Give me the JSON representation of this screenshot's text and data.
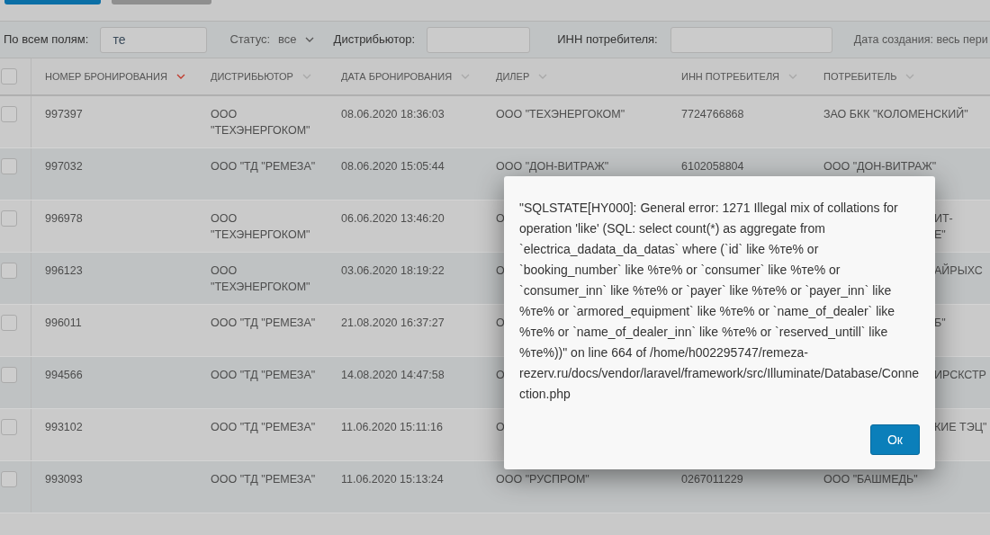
{
  "toolbar": {
    "buttons": [
      {
        "kind": "primary"
      },
      {
        "kind": "secondary"
      }
    ]
  },
  "filters": {
    "all_fields": {
      "label": "По всем полям:",
      "value": "те"
    },
    "status": {
      "label": "Статус:",
      "value": "все"
    },
    "distributor": {
      "label": "Дистрибьютор:"
    },
    "consumer_inn": {
      "label": "ИНН потребителя:"
    },
    "created": {
      "label": "Дата создания: весь пери"
    }
  },
  "table": {
    "header_checked": false,
    "columns": [
      {
        "label": "НОМЕР БРОНИРОВАНИЯ",
        "sorted": true
      },
      {
        "label": "ДИСТРИБЬЮТОР",
        "sorted": false
      },
      {
        "label": "ДАТА БРОНИРОВАНИЯ",
        "sorted": false
      },
      {
        "label": "ДИЛЕР",
        "sorted": false
      },
      {
        "label": "ИНН ПОТРЕБИТЕЛЯ",
        "sorted": false
      },
      {
        "label": "ПОТРЕБИТЕЛЬ",
        "sorted": false
      }
    ],
    "rows": [
      {
        "checked": false,
        "covered": false,
        "cells": [
          "997397",
          "ООО \"ТЕХЭНЕРГОКОМ\"",
          "08.06.2020 18:36:03",
          "ООО \"ТЕХЭНЕРГОКОМ\"",
          "7724766868",
          "ЗАО БКК \"КОЛОМЕНСКИЙ\""
        ]
      },
      {
        "checked": false,
        "covered": false,
        "cells": [
          "997032",
          "ООО \"ТД \"РЕМЕЗА\"",
          "08.06.2020 15:05:44",
          "ООО \"ДОН-ВИТРАЖ\"",
          "6102058804",
          "ООО \"ДОН-ВИТРАЖ\""
        ]
      },
      {
        "checked": false,
        "covered": true,
        "cells": [
          "996978",
          "ООО \"ТЕХЭНЕРГОКОМ\"",
          "06.06.2020 13:46:20",
          "О",
          "",
          "ИТ-\nЕ\""
        ]
      },
      {
        "checked": false,
        "covered": true,
        "cells": [
          "996123",
          "ООО \"ТЕХЭНЕРГОКОМ\"",
          "03.06.2020 18:19:22",
          "О",
          "",
          "АЙРЫХС"
        ]
      },
      {
        "checked": false,
        "covered": true,
        "cells": [
          "996011",
          "ООО \"ТД \"РЕМЕЗА\"",
          "21.08.2020 16:37:27",
          "О",
          "",
          "Б\""
        ]
      },
      {
        "checked": false,
        "covered": true,
        "cells": [
          "994566",
          "ООО \"ТД \"РЕМЕЗА\"",
          "14.08.2020 14:47:58",
          "О",
          "",
          "ИРСКСТР"
        ]
      },
      {
        "checked": false,
        "covered": true,
        "cells": [
          "993102",
          "ООО \"ТД \"РЕМЕЗА\"",
          "11.06.2020 15:11:16",
          "О",
          "",
          "КИЕ ТЭЦ\""
        ]
      },
      {
        "checked": false,
        "covered": false,
        "cells": [
          "993093",
          "ООО \"ТД \"РЕМЕЗА\"",
          "11.06.2020 15:13:24",
          "ООО \"РУСПРОМ\"",
          "0267011229",
          "ООО \"БАШМЕДЬ\""
        ]
      }
    ]
  },
  "dialog": {
    "message": "\"SQLSTATE[HY000]: General error: 1271 Illegal mix of collations for operation 'like' (SQL: select count(*) as aggregate from `electrica_dadata_da_datas` where (`id` like %те% or `booking_number` like %те% or `consumer` like %те% or `consumer_inn` like %те% or `payer` like %те% or `payer_inn` like %те% or `armored_equipment` like %те% or `name_of_dealer` like %те% or `name_of_dealer_inn` like %те% or `reserved_untill` like %те%))\" on line 664 of /home/h002295747/remeza-rezerv.ru/docs/vendor/laravel/framework/src/Illuminate/Database/Connection.php",
    "button": "Ок"
  }
}
